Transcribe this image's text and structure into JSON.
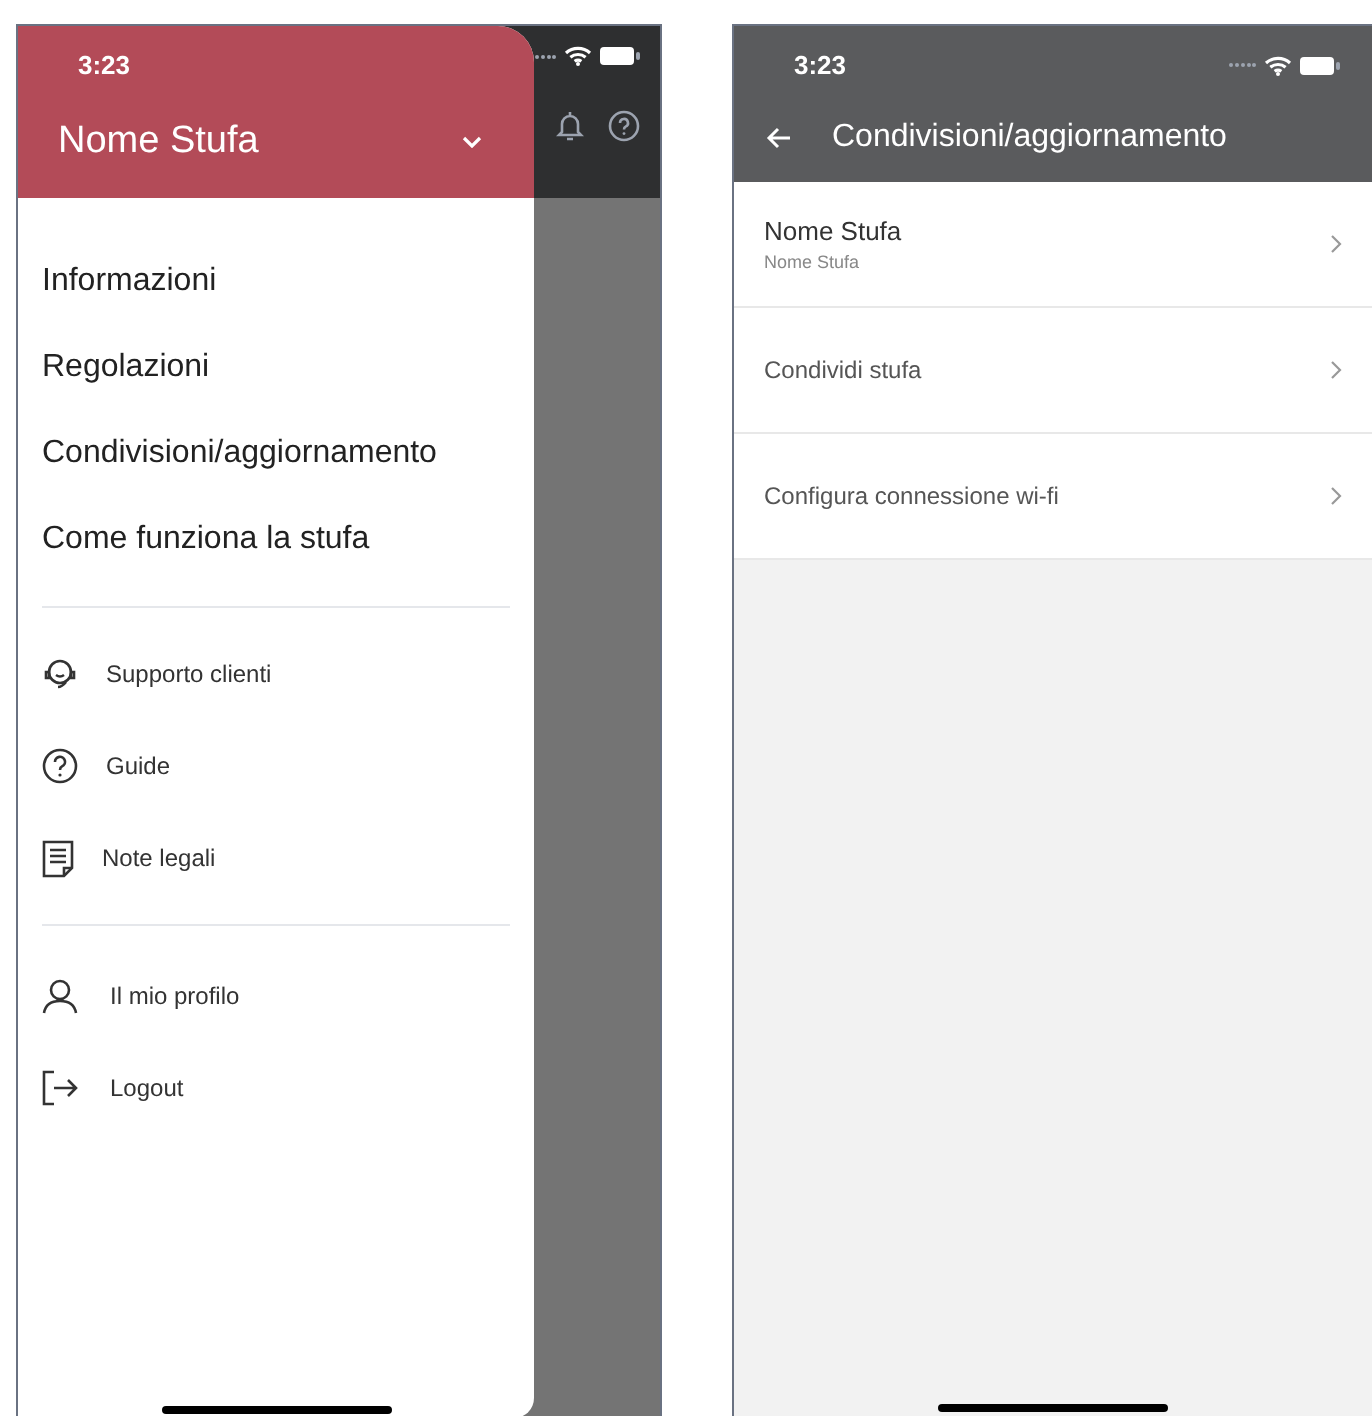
{
  "left_screen": {
    "status_bar": {
      "time": "3:23"
    },
    "drawer": {
      "title": "Nome Stufa",
      "main_items": [
        {
          "label": "Informazioni"
        },
        {
          "label": "Regolazioni"
        },
        {
          "label": "Condivisioni/aggiornamento"
        },
        {
          "label": "Come funziona la stufa"
        }
      ],
      "support_items": [
        {
          "kind": "headset",
          "label": "Supporto clienti"
        },
        {
          "kind": "help",
          "label": "Guide"
        },
        {
          "kind": "document",
          "label": "Note legali"
        }
      ],
      "account_items": [
        {
          "kind": "user",
          "label": "Il mio profilo"
        },
        {
          "kind": "logout",
          "label": "Logout"
        }
      ]
    }
  },
  "right_screen": {
    "status_bar": {
      "time": "3:23"
    },
    "title": "Condivisioni/aggiornamento",
    "rows": [
      {
        "title": "Nome Stufa",
        "subtitle": "Nome Stufa"
      },
      {
        "title": "Condividi stufa"
      },
      {
        "title": "Configura connessione wi-fi"
      }
    ]
  }
}
